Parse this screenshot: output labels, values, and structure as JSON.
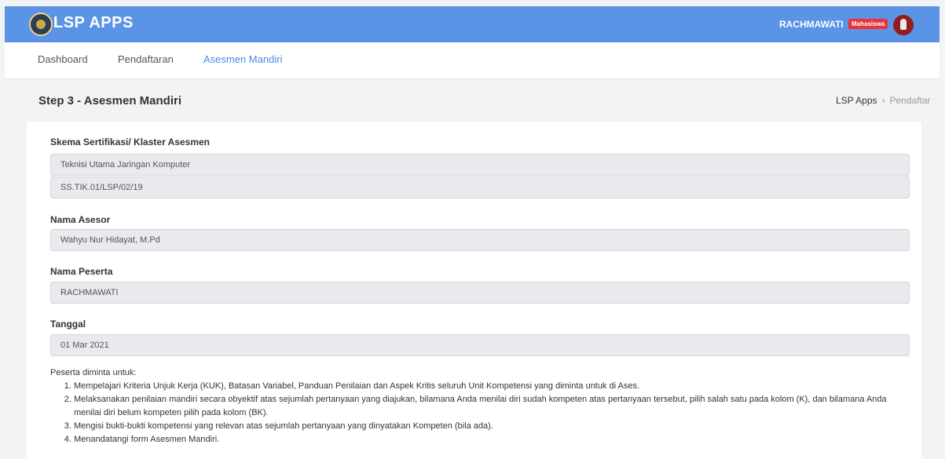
{
  "header": {
    "logo_text": "LSP APPS",
    "user_name": "RACHMAWATI",
    "role_badge": "Mahasiswa"
  },
  "nav": {
    "items": [
      {
        "label": "Dashboard",
        "active": false
      },
      {
        "label": "Pendaftaran",
        "active": false
      },
      {
        "label": "Asesmen Mandiri",
        "active": true
      }
    ]
  },
  "page": {
    "title": "Step 3 - Asesmen Mandiri",
    "breadcrumb": [
      "LSP Apps",
      "Pendaftar"
    ]
  },
  "form": {
    "skema_label": "Skema Sertifikasi/ Klaster Asesmen",
    "skema_name": "Teknisi Utama Jaringan Komputer",
    "skema_code": "SS.TIK.01/LSP/02/19",
    "asesor_label": "Nama Asesor",
    "asesor_value": "Wahyu Nur Hidayat, M.Pd",
    "peserta_label": "Nama Peserta",
    "peserta_value": "RACHMAWATI",
    "tanggal_label": "Tanggal",
    "tanggal_value": "01 Mar 2021"
  },
  "instructions": {
    "intro": "Peserta diminta untuk:",
    "items": [
      "Mempelajari Kriteria Unjuk Kerja (KUK), Batasan Variabel, Panduan Penilaian dan Aspek Kritis seluruh Unit Kompetensi yang diminta untuk di Ases.",
      "Melaksanakan penilaian mandiri secara obyektif atas sejumlah pertanyaan yang diajukan, bilamana Anda menilai diri sudah kompeten atas pertanyaan tersebut, pilih salah satu pada kolom (K), dan bilamana Anda menilai diri belum kompeten pilih pada kolom (BK).",
      "Mengisi bukti-bukti kompetensi yang relevan atas sejumlah pertanyaan yang dinyatakan Kompeten (bila ada).",
      "Menandatangi form Asesmen Mandiri."
    ]
  },
  "colors": {
    "topbar": "#5b93e6",
    "active_nav": "#4a8be0",
    "badge": "#e8333a"
  }
}
